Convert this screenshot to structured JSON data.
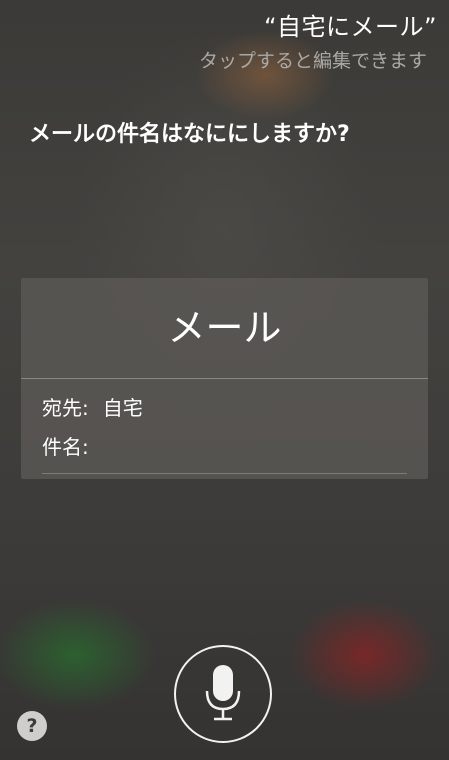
{
  "siri": {
    "utterance": "“自宅にメール”",
    "edit_hint": "タップすると編集できます",
    "question": "メールの件名はなににしますか?"
  },
  "mail_card": {
    "title": "メール",
    "to_label": "宛先:",
    "to_value": "自宅",
    "subject_label": "件名:",
    "subject_value": ""
  },
  "controls": {
    "mic_icon": "microphone-icon",
    "help_icon": "question-mark-icon",
    "help_glyph": "?"
  },
  "colors": {
    "text_primary": "#ffffff",
    "text_secondary": "#a9a8a5",
    "card_background": "#5c5a56",
    "help_button": "#cfcecb"
  }
}
